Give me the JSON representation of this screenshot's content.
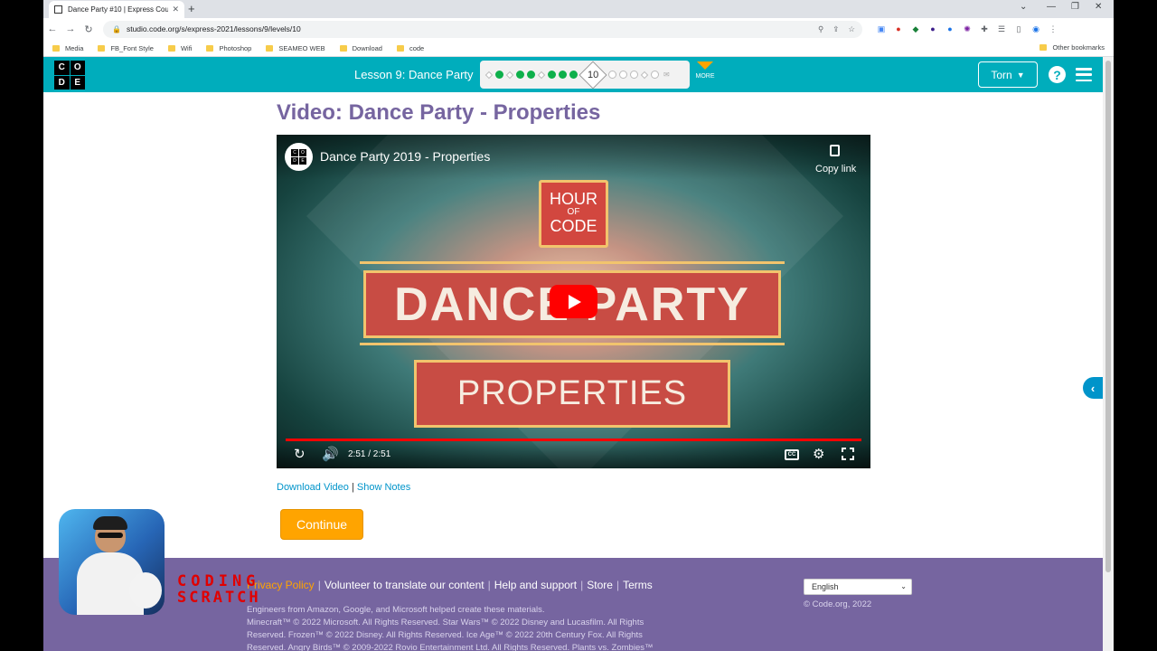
{
  "browser": {
    "tab_title": "Dance Party #10 | Express Course...",
    "url": "studio.code.org/s/express-2021/lessons/9/levels/10",
    "bookmarks": [
      "Media",
      "FB_Font Style",
      "Wifi",
      "Photoshop",
      "SEAMEO WEB",
      "Download",
      "code"
    ],
    "other_bookmarks": "Other bookmarks"
  },
  "header": {
    "logo_letters": [
      "C",
      "O",
      "D",
      "E"
    ],
    "lesson": "Lesson 9: Dance Party",
    "current_level": "10",
    "more": "MORE",
    "user": "Torn"
  },
  "video": {
    "page_title": "Video: Dance Party - Properties",
    "player_title": "Dance Party 2019 - Properties",
    "copy_link": "Copy link",
    "time": "2:51 / 2:51",
    "progress": 1.0,
    "thumb_hoc_lines": [
      "HOUR",
      "OF",
      "CODE"
    ],
    "thumb_main": "DANCE PARTY",
    "thumb_sub": "PROPERTIES"
  },
  "links": {
    "download": "Download Video",
    "separator": "|",
    "notes": "Show Notes"
  },
  "continue_label": "Continue",
  "footer": {
    "links": [
      "Privacy Policy",
      "Volunteer to translate our content",
      "Help and support",
      "Store",
      "Terms"
    ],
    "line1": "Engineers from Amazon, Google, and Microsoft helped create these materials.",
    "line2": "Minecraft™ © 2022 Microsoft. All Rights Reserved. Star Wars™ © 2022 Disney and Lucasfilm. All Rights",
    "line3": "Reserved. Frozen™ © 2022 Disney. All Rights Reserved. Ice Age™ © 2022 20th Century Fox. All Rights",
    "line4": "Reserved. Angry Birds™ © 2009-2022 Rovio Entertainment Ltd. All Rights Reserved. Plants vs. Zombies™",
    "language": "English",
    "copyright": "© Code.org, 2022"
  },
  "overlay": {
    "brand_line1": "CODING",
    "brand_line2": "SCRATCH"
  },
  "colors": {
    "teal": "#00adbc",
    "purple": "#7665a0",
    "orange": "#ffa400",
    "green": "#0eb04b"
  }
}
